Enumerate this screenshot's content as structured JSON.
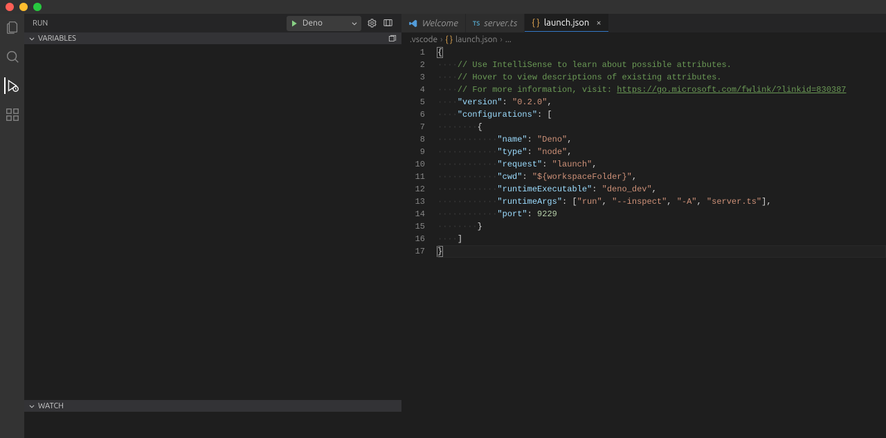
{
  "run": {
    "title": "RUN",
    "config_name": "Deno"
  },
  "sections": {
    "variables": "VARIABLES",
    "watch": "WATCH"
  },
  "tabs": {
    "welcome": "Welcome",
    "server": "server.ts",
    "launch": "launch.json"
  },
  "breadcrumb": {
    "folder": ".vscode",
    "file": "launch.json",
    "trail": "..."
  },
  "code": {
    "line1": "{",
    "comment1": "// Use IntelliSense to learn about possible attributes.",
    "comment2": "// Hover to view descriptions of existing attributes.",
    "comment3_prefix": "// For more information, visit: ",
    "comment3_link": "https://go.microsoft.com/fwlink/?linkid=830387",
    "k_version": "\"version\"",
    "v_version": "\"0.2.0\"",
    "k_configs": "\"configurations\"",
    "k_name": "\"name\"",
    "v_name": "\"Deno\"",
    "k_type": "\"type\"",
    "v_type": "\"node\"",
    "k_request": "\"request\"",
    "v_request": "\"launch\"",
    "k_cwd": "\"cwd\"",
    "v_cwd": "\"${workspaceFolder}\"",
    "k_rexec": "\"runtimeExecutable\"",
    "v_rexec": "\"deno_dev\"",
    "k_rargs": "\"runtimeArgs\"",
    "v_rargs1": "\"run\"",
    "v_rargs2": "\"--inspect\"",
    "v_rargs3": "\"-A\"",
    "v_rargs4": "\"server.ts\"",
    "k_port": "\"port\"",
    "v_port": "9229"
  }
}
